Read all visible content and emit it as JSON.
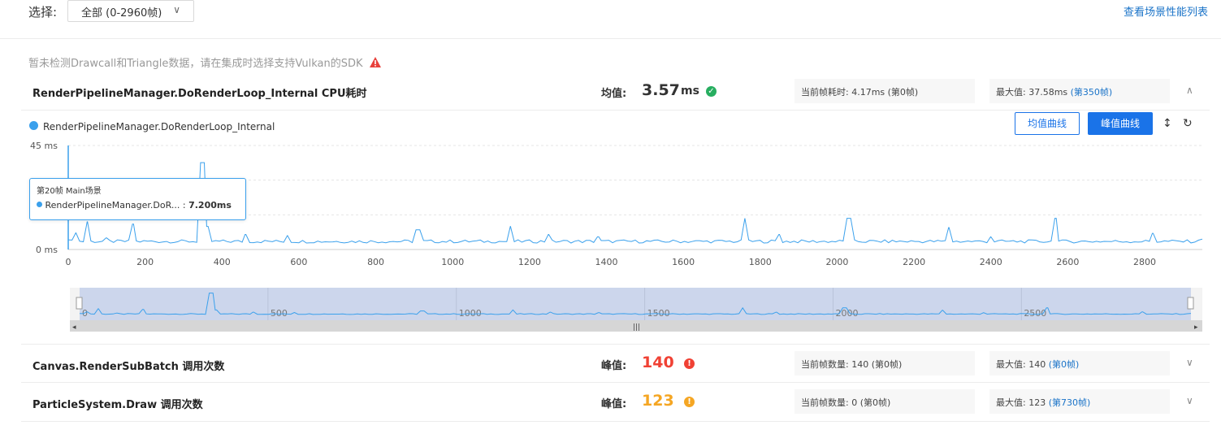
{
  "header": {
    "select_label": "选择:",
    "select_value": "全部 (0-2960帧)",
    "top_link": "查看场景性能列表"
  },
  "warning": "暂未检测Drawcall和Triangle数据，请在集成时选择支持Vulkan的SDK",
  "rows": [
    {
      "title": "RenderPipelineManager.DoRenderLoop_Internal CPU耗时",
      "metric_label": "均值:",
      "metric_value": "3.57",
      "metric_unit": "ms",
      "status": "good",
      "status_color": "#27ae60",
      "current": "当前帧耗时: 4.17ms (第0帧)",
      "max_prefix": "最大值: 37.58ms ",
      "max_link": "(第350帧)",
      "expanded": true
    },
    {
      "title": "Canvas.RenderSubBatch 调用次数",
      "metric_label": "峰值:",
      "metric_value": "140",
      "status": "error",
      "status_color": "#f04134",
      "current": "当前帧数量: 140 (第0帧)",
      "max_prefix": "最大值: 140 ",
      "max_link": "(第0帧)",
      "expanded": false
    },
    {
      "title": "ParticleSystem.Draw 调用次数",
      "metric_label": "峰值:",
      "metric_value": "123",
      "status": "warning",
      "status_color": "#f5a623",
      "current": "当前帧数量: 0 (第0帧)",
      "max_prefix": "最大值: 123 ",
      "max_link": "(第730帧)",
      "expanded": false
    }
  ],
  "chart_panel": {
    "legend": "RenderPipelineManager.DoRenderLoop_Internal",
    "btn_avg": "均值曲线",
    "btn_peak": "峰值曲线",
    "y_top": "45 ms",
    "y_bottom": "0 ms",
    "tooltip_title": "第20帧 Main场景",
    "tooltip_series": "RenderPipelineManager.DoR...",
    "tooltip_sep": ":",
    "tooltip_value": "7.200ms",
    "nav_ticks": [
      "0",
      "500",
      "1000",
      "1500",
      "2000",
      "2500"
    ]
  },
  "chart_data": {
    "type": "line",
    "title": "",
    "series": [
      {
        "name": "RenderPipelineManager.DoRenderLoop_Internal",
        "color": "#3aa0ec"
      }
    ],
    "ylim": [
      0,
      45
    ],
    "xlim": [
      0,
      2950
    ],
    "x_ticks": [
      0,
      200,
      400,
      600,
      800,
      1000,
      1200,
      1400,
      1600,
      1800,
      2000,
      2200,
      2400,
      2600,
      2800
    ],
    "baseline_ms": 3.5,
    "peaks": [
      [
        0,
        4.2
      ],
      [
        20,
        7.2
      ],
      [
        50,
        12
      ],
      [
        100,
        5
      ],
      [
        170,
        11
      ],
      [
        350,
        37.58
      ],
      [
        360,
        10
      ],
      [
        460,
        6.5
      ],
      [
        570,
        6
      ],
      [
        910,
        8.5
      ],
      [
        1150,
        10
      ],
      [
        1250,
        6.5
      ],
      [
        1380,
        5.5
      ],
      [
        1760,
        13.5
      ],
      [
        1850,
        6.5
      ],
      [
        2030,
        13.5
      ],
      [
        2290,
        9.5
      ],
      [
        2400,
        5.5
      ],
      [
        2570,
        13.5
      ],
      [
        2820,
        7
      ],
      [
        2950,
        4.5
      ]
    ]
  }
}
